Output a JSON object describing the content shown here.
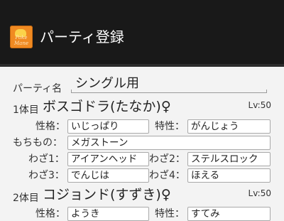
{
  "app_bar": {
    "icon_line1": "Poke",
    "icon_line2": "Mane",
    "title": "パーティ登録"
  },
  "party": {
    "label": "パーティ名",
    "name": "シングル用"
  },
  "labels": {
    "nature": "性格：",
    "ability": "特性：",
    "item": "もちもの：",
    "move1": "わざ1：",
    "move2": "わざ2：",
    "move3": "わざ3：",
    "move4": "わざ4："
  },
  "pokemon": [
    {
      "slot": "1体目",
      "name": "ボスゴドラ(たなか)♀",
      "level": "Lv:50",
      "nature": "いじっぱり",
      "ability": "がんじょう",
      "item": "メガストーン",
      "moves": [
        "アイアンヘッド",
        "ステルスロック",
        "でんじは",
        "ほえる"
      ]
    },
    {
      "slot": "2体目",
      "name": "コジョンド(すずき)♀",
      "level": "Lv:50",
      "nature": "ようき",
      "ability": "すてみ"
    }
  ]
}
